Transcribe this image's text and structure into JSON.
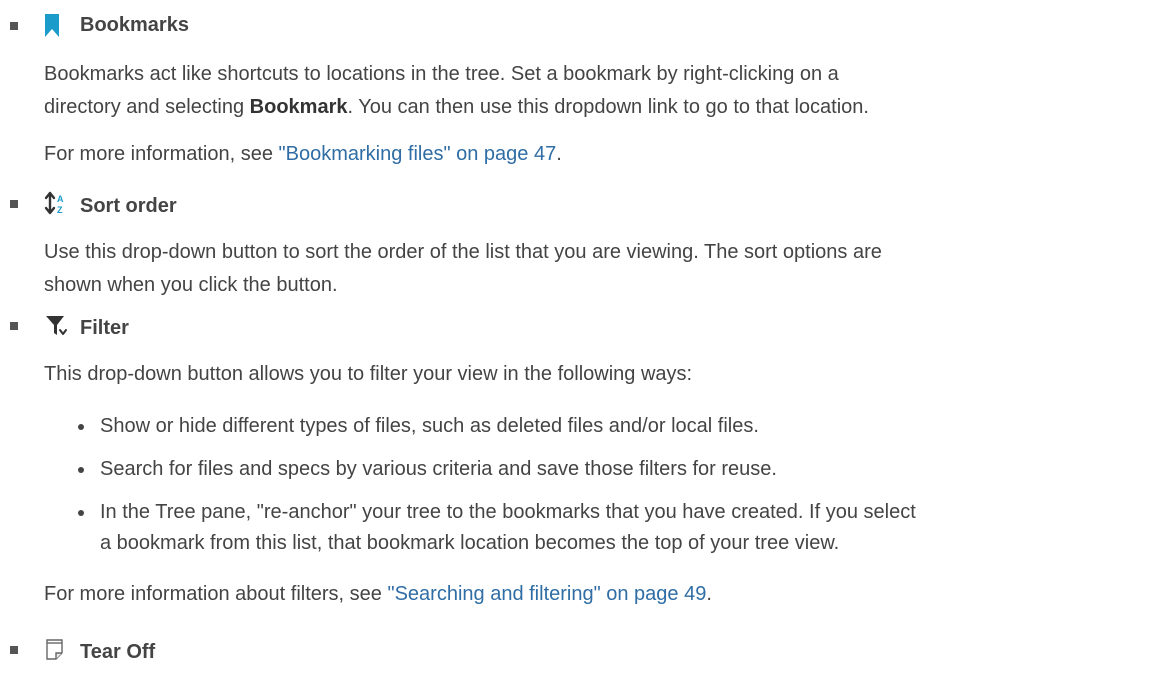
{
  "sections": {
    "bookmarks": {
      "title": "Bookmarks",
      "icon": "bookmark-icon",
      "icon_color": "#1a9bc9",
      "para1_a": "Bookmarks act like shortcuts to locations in the tree. Set a bookmark by right-clicking on a",
      "para1_b": "directory and selecting ",
      "para1_bold": "Bookmark",
      "para1_c": ". You can then use this dropdown link to go to that location.",
      "para2_prefix": "For more information, see ",
      "para2_link": "\"Bookmarking files\" on page 47",
      "para2_suffix": "."
    },
    "sort_order": {
      "title": "Sort order",
      "icon": "sort-az-icon",
      "para1_a": "Use this drop-down button to sort the order of the list that you are viewing. The sort options are",
      "para1_b": "shown when you click the button."
    },
    "filter": {
      "title": "Filter",
      "icon": "filter-icon",
      "intro": "This drop-down button allows you to filter your view in the following ways:",
      "bullets": [
        "Show or hide different types of files, such as deleted files and/or local files.",
        "Search for files and specs by various criteria and save those filters for reuse.",
        "In the Tree pane, \"re-anchor\" your tree to the bookmarks that you have created. If you select",
        "a bookmark from this list, that bookmark location becomes the top of your tree view."
      ],
      "more_prefix": "For more information about filters, see ",
      "more_link": "\"Searching and filtering\" on page 49",
      "more_suffix": "."
    },
    "tear_off": {
      "title": "Tear Off",
      "icon": "tear-off-icon"
    }
  },
  "colors": {
    "text": "#444444",
    "link": "#2f6da4",
    "bullet": "#555555"
  }
}
